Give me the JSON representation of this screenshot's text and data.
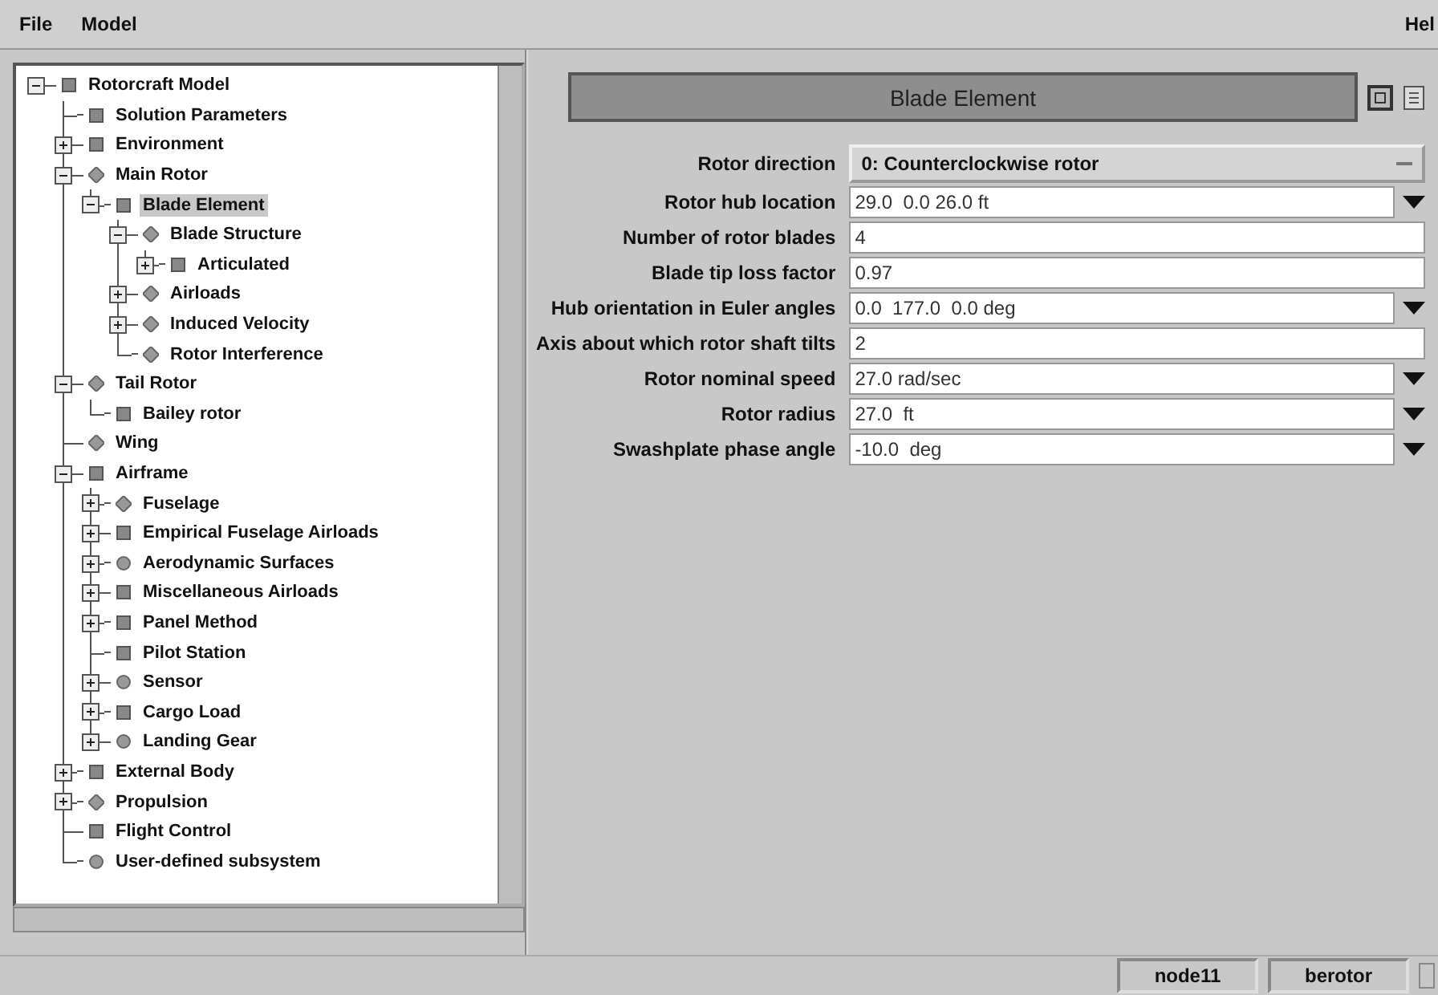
{
  "menu": {
    "items": [
      "File",
      "Model"
    ],
    "help": "Hel"
  },
  "tree": [
    {
      "label": "Rotorcraft Model",
      "kind": "square",
      "expanded": true,
      "selected": false,
      "children": [
        {
          "label": "Solution Parameters",
          "kind": "square",
          "selected": false
        },
        {
          "label": "Environment",
          "kind": "square",
          "expanded": false,
          "selected": false
        },
        {
          "label": "Main Rotor",
          "kind": "diamond",
          "expanded": true,
          "selected": false,
          "children": [
            {
              "label": "Blade Element",
              "kind": "square",
              "expanded": true,
              "selected": true,
              "children": [
                {
                  "label": "Blade Structure",
                  "kind": "diamond",
                  "expanded": true,
                  "selected": false,
                  "children": [
                    {
                      "label": "Articulated",
                      "kind": "square",
                      "expanded": false,
                      "selected": false
                    }
                  ]
                },
                {
                  "label": "Airloads",
                  "kind": "diamond",
                  "expanded": false,
                  "selected": false
                },
                {
                  "label": "Induced Velocity",
                  "kind": "diamond",
                  "expanded": false,
                  "selected": false
                },
                {
                  "label": "Rotor Interference",
                  "kind": "diamond",
                  "selected": false
                }
              ]
            }
          ]
        },
        {
          "label": "Tail Rotor",
          "kind": "diamond",
          "expanded": true,
          "selected": false,
          "children": [
            {
              "label": "Bailey rotor",
              "kind": "square",
              "selected": false
            }
          ]
        },
        {
          "label": "Wing",
          "kind": "diamond",
          "selected": false
        },
        {
          "label": "Airframe",
          "kind": "square",
          "expanded": true,
          "selected": false,
          "children": [
            {
              "label": "Fuselage",
              "kind": "diamond",
              "expanded": false,
              "selected": false
            },
            {
              "label": "Empirical Fuselage Airloads",
              "kind": "square",
              "expanded": false,
              "selected": false
            },
            {
              "label": "Aerodynamic Surfaces",
              "kind": "circle",
              "expanded": false,
              "selected": false
            },
            {
              "label": "Miscellaneous Airloads",
              "kind": "square",
              "expanded": false,
              "selected": false
            },
            {
              "label": "Panel Method",
              "kind": "square",
              "expanded": false,
              "selected": false
            },
            {
              "label": "Pilot Station",
              "kind": "square",
              "selected": false
            },
            {
              "label": "Sensor",
              "kind": "circle",
              "expanded": false,
              "selected": false
            },
            {
              "label": "Cargo Load",
              "kind": "square",
              "expanded": false,
              "selected": false
            },
            {
              "label": "Landing Gear",
              "kind": "circle",
              "expanded": false,
              "selected": false
            }
          ]
        },
        {
          "label": "External Body",
          "kind": "square",
          "expanded": false,
          "selected": false
        },
        {
          "label": "Propulsion",
          "kind": "diamond",
          "expanded": false,
          "selected": false
        },
        {
          "label": "Flight Control",
          "kind": "square",
          "selected": false
        },
        {
          "label": "User-defined subsystem",
          "kind": "circle",
          "selected": false
        }
      ]
    }
  ],
  "panel": {
    "title": "Blade Element",
    "fields": [
      {
        "label": "Rotor direction",
        "kind": "option",
        "value": "0: Counterclockwise rotor"
      },
      {
        "label": "Rotor hub location",
        "kind": "combo",
        "value": "29.0  0.0 26.0 ft"
      },
      {
        "label": "Number of rotor blades",
        "kind": "text",
        "value": "4"
      },
      {
        "label": "Blade tip loss factor",
        "kind": "text",
        "value": "0.97"
      },
      {
        "label": "Hub orientation in Euler angles",
        "kind": "combo",
        "value": "0.0  177.0  0.0 deg"
      },
      {
        "label": "Axis about which rotor shaft tilts",
        "kind": "text",
        "value": "2"
      },
      {
        "label": "Rotor nominal speed",
        "kind": "combo",
        "value": "27.0 rad/sec"
      },
      {
        "label": "Rotor radius",
        "kind": "combo",
        "value": "27.0  ft"
      },
      {
        "label": "Swashplate phase angle",
        "kind": "combo",
        "value": "-10.0  deg"
      }
    ]
  },
  "status_bar": [
    "node11",
    "berotor"
  ]
}
